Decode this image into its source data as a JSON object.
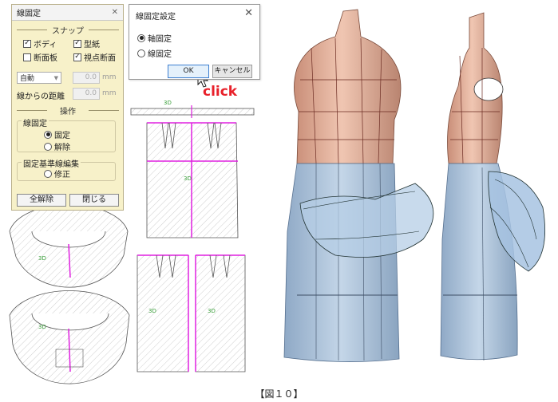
{
  "snap_panel": {
    "title": "線固定",
    "snap_header": "スナップ",
    "checkboxes": [
      {
        "label": "ボディ",
        "checked": true
      },
      {
        "label": "型紙",
        "checked": true
      },
      {
        "label": "断面板",
        "checked": false
      },
      {
        "label": "視点断面",
        "checked": true
      }
    ],
    "mode_select": "自動",
    "value1": "0.0",
    "unit1": "mm",
    "distance_label": "線からの距離",
    "value2": "0.0",
    "unit2": "mm",
    "operation_header": "操作",
    "line_fix_group": "線固定",
    "radio_fix": "固定",
    "radio_release": "解除",
    "base_edit_group": "固定基準線編集",
    "radio_modify": "修正",
    "clear_all_button": "全解除",
    "close_button": "閉じる"
  },
  "dialog": {
    "title": "線固定設定",
    "option_axis": "軸固定",
    "option_line": "線固定",
    "selected": "軸固定",
    "ok_button": "OK",
    "cancel_button": "キャンセル"
  },
  "annotation": {
    "click_text": "click",
    "color": "#e8202a"
  },
  "pattern_labels": {
    "label_3d": "3D"
  },
  "caption": "【図１０】",
  "colors": {
    "panel_bg": "#f7f1c9",
    "pattern_line": "#e020e0",
    "mannequin_skin": "#e7b9a3",
    "skirt_blue": "#a9c3dc"
  }
}
